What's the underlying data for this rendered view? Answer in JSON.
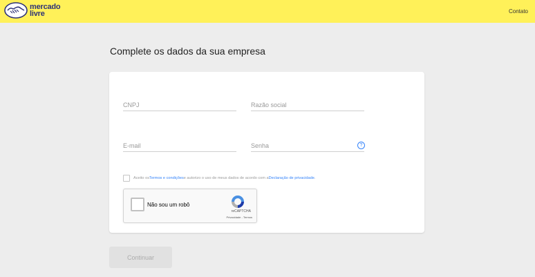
{
  "header": {
    "logo_text_line1": "mercado",
    "logo_text_line2": "livre",
    "contact_label": "Contato",
    "background_color": "#fff159"
  },
  "page": {
    "title": "Complete os dados da sua empresa"
  },
  "form": {
    "cnpj": {
      "placeholder": "CNPJ",
      "value": ""
    },
    "company_name": {
      "placeholder": "Razão social",
      "value": ""
    },
    "email": {
      "placeholder": "E-mail",
      "value": ""
    },
    "password": {
      "placeholder": "Senha",
      "value": ""
    },
    "password_help_icon": "question-circle-icon",
    "terms": {
      "checked": false,
      "text_before": "Aceito os ",
      "terms_link": "Termos e condições",
      "text_middle": " e autorizo o uso de meus dados de acordo com a ",
      "privacy_link": "Declaração de privacidade",
      "text_after": "."
    },
    "recaptcha": {
      "label": "Não sou um robô",
      "brand": "reCAPTCHA",
      "links": "Privacidade - Termos"
    },
    "submit_label": "Continuar"
  },
  "colors": {
    "link": "#3483fa",
    "brand_blue": "#2d3277",
    "disabled_button_bg": "#e1e1e1"
  }
}
